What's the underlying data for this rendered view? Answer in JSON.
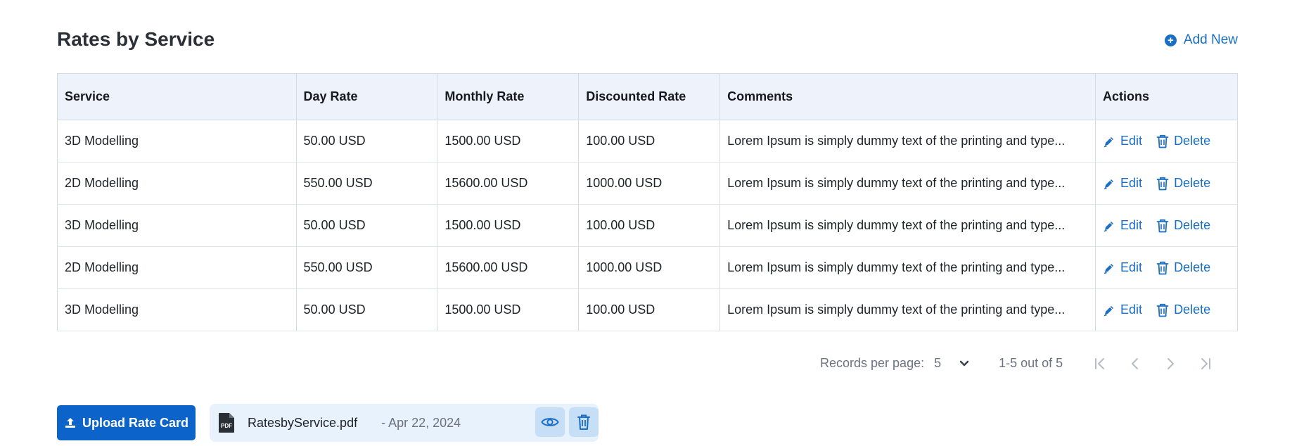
{
  "header": {
    "title": "Rates by Service",
    "add_new_label": "Add New"
  },
  "table": {
    "columns": [
      "Service",
      "Day Rate",
      "Monthly Rate",
      "Discounted Rate",
      "Comments",
      "Actions"
    ],
    "rows": [
      {
        "service": "3D Modelling",
        "day_rate": "50.00 USD",
        "monthly_rate": "1500.00 USD",
        "discounted_rate": "100.00 USD",
        "comments": "Lorem Ipsum is simply dummy text of the printing and type..."
      },
      {
        "service": "2D Modelling",
        "day_rate": "550.00 USD",
        "monthly_rate": "15600.00 USD",
        "discounted_rate": "1000.00 USD",
        "comments": "Lorem Ipsum is simply dummy text of the printing and type..."
      },
      {
        "service": "3D Modelling",
        "day_rate": "50.00 USD",
        "monthly_rate": "1500.00 USD",
        "discounted_rate": "100.00 USD",
        "comments": "Lorem Ipsum is simply dummy text of the printing and type..."
      },
      {
        "service": "2D Modelling",
        "day_rate": "550.00 USD",
        "monthly_rate": "15600.00 USD",
        "discounted_rate": "1000.00 USD",
        "comments": "Lorem Ipsum is simply dummy text of the printing and type..."
      },
      {
        "service": "3D Modelling",
        "day_rate": "50.00 USD",
        "monthly_rate": "1500.00 USD",
        "discounted_rate": "100.00 USD",
        "comments": "Lorem Ipsum is simply dummy text of the printing and type..."
      }
    ],
    "edit_label": "Edit",
    "delete_label": "Delete"
  },
  "pagination": {
    "records_per_page_label": "Records per page:",
    "records_per_page_value": "5",
    "range_text": "1-5 out of 5"
  },
  "upload": {
    "button_label": "Upload Rate Card",
    "file_name": "RatesbyService.pdf",
    "file_date": "- Apr 22, 2024"
  },
  "icons": {
    "add": "plus-circle-icon",
    "edit": "pencil-icon",
    "delete": "trash-icon",
    "dropdown": "chevron-down-icon",
    "first": "first-page-icon",
    "prev": "chevron-left-icon",
    "next": "chevron-right-icon",
    "last": "last-page-icon",
    "upload": "upload-icon",
    "file": "pdf-file-icon",
    "view": "eye-icon"
  },
  "colors": {
    "accent": "#1a6fc2",
    "primary_button": "#0c63c9",
    "header_bg": "#eef3fb",
    "file_chip_bg": "#e8f2fd"
  }
}
